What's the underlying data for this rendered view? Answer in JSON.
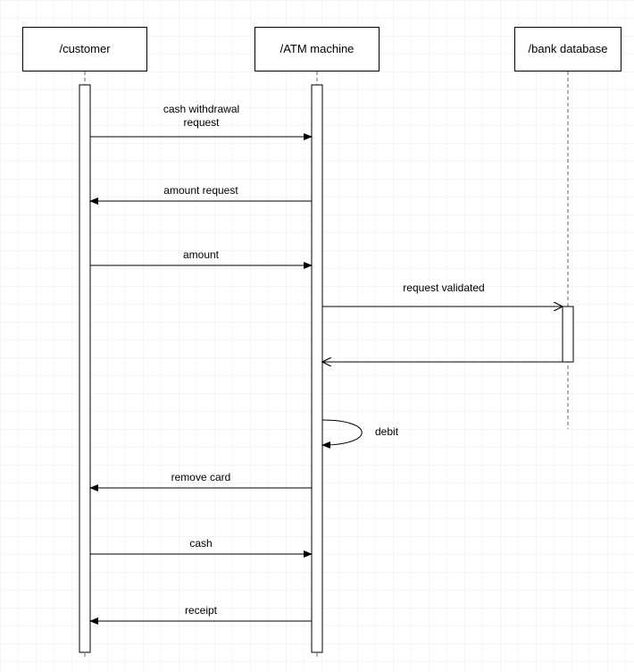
{
  "participants": {
    "customer": "/customer",
    "atm": "/ATM machine",
    "bank": "/bank database"
  },
  "messages": {
    "m1": "cash withdrawal\nrequest",
    "m2": "amount request",
    "m3": "amount",
    "m4": "request validated",
    "m5": "debit",
    "m6": "remove card",
    "m7": "cash",
    "m8": "receipt"
  }
}
